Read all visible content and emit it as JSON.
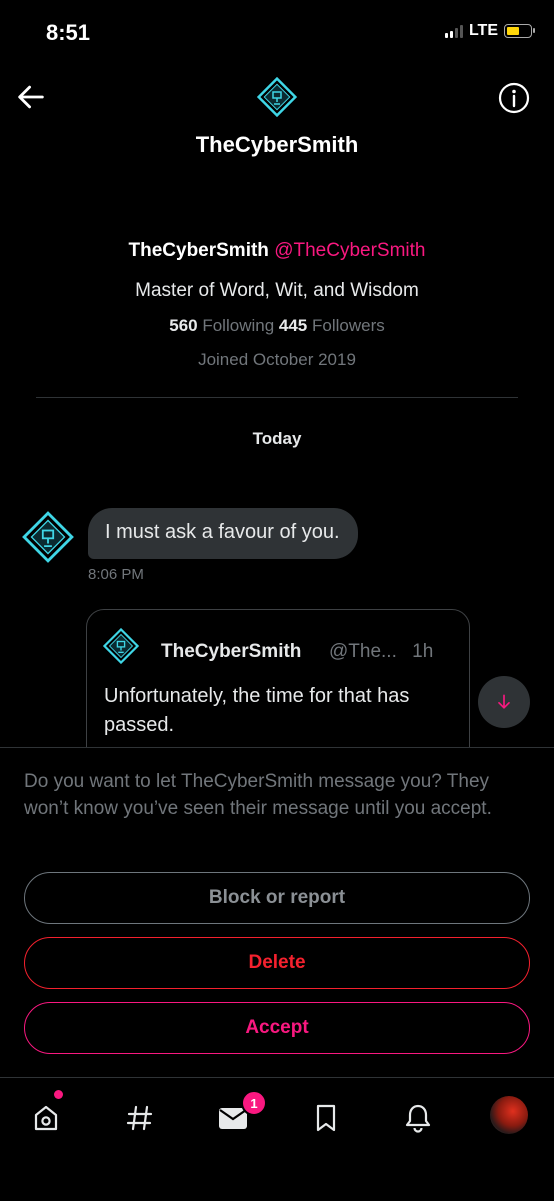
{
  "status_bar": {
    "time": "8:51",
    "network": "LTE"
  },
  "header": {
    "title": "TheCyberSmith",
    "back_icon": "arrow-left-icon",
    "info_icon": "info-icon"
  },
  "profile": {
    "name": "TheCyberSmith",
    "handle": "@TheCyberSmith",
    "bio": "Master of Word, Wit, and Wisdom",
    "following_count": "560",
    "following_label": "Following",
    "followers_count": "445",
    "followers_label": "Followers",
    "joined": "Joined October 2019"
  },
  "conversation": {
    "date_separator": "Today",
    "messages": [
      {
        "text": "I must ask a favour of you.",
        "time": "8:06 PM"
      }
    ],
    "quoted_tweet": {
      "name": "TheCyberSmith",
      "handle": "@The...",
      "age": "1h",
      "text": "Unfortunately, the time for that has passed."
    }
  },
  "request_panel": {
    "prompt": "Do you want to let TheCyberSmith message you? They won’t know you’ve seen their message until you accept.",
    "block_label": "Block or report",
    "delete_label": "Delete",
    "accept_label": "Accept"
  },
  "tabbar": {
    "items": [
      "home-icon",
      "explore-hashtag-icon",
      "messages-icon",
      "bookmarks-icon",
      "notifications-icon",
      "profile-avatar"
    ],
    "messages_badge": "1"
  },
  "colors": {
    "accent": "#f91880",
    "danger": "#f4212e",
    "logo_cyan": "#3fd6e6",
    "bubble_bg": "#2f3336",
    "muted_text": "#71767b"
  }
}
